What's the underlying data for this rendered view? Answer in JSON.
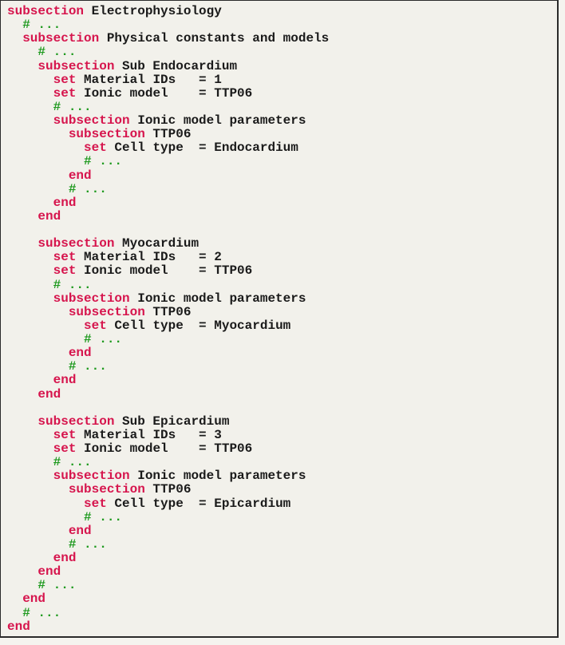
{
  "colors": {
    "keyword": "#d6154d",
    "comment": "#1f9a1f",
    "text": "#1a1a1a",
    "background": "#f2f1eb"
  },
  "lines": [
    {
      "indent": 0,
      "kw": "subsection",
      "text": " Electrophysiology"
    },
    {
      "indent": 1,
      "comment": "# ..."
    },
    {
      "indent": 1,
      "kw": "subsection",
      "text": " Physical constants and models"
    },
    {
      "indent": 2,
      "comment": "# ..."
    },
    {
      "indent": 2,
      "kw": "subsection",
      "text": " Sub Endocardium"
    },
    {
      "indent": 3,
      "kw": "set",
      "text": " Material IDs   = 1"
    },
    {
      "indent": 3,
      "kw": "set",
      "text": " Ionic model    = TTP06"
    },
    {
      "indent": 3,
      "comment": "# ..."
    },
    {
      "indent": 3,
      "kw": "subsection",
      "text": " Ionic model parameters"
    },
    {
      "indent": 4,
      "kw": "subsection",
      "text": " TTP06"
    },
    {
      "indent": 5,
      "kw": "set",
      "text": " Cell type  = Endocardium"
    },
    {
      "indent": 5,
      "comment": "# ..."
    },
    {
      "indent": 4,
      "kw": "end"
    },
    {
      "indent": 4,
      "comment": "# ..."
    },
    {
      "indent": 3,
      "kw": "end"
    },
    {
      "indent": 2,
      "kw": "end"
    },
    {
      "indent": 0
    },
    {
      "indent": 2,
      "kw": "subsection",
      "text": " Myocardium"
    },
    {
      "indent": 3,
      "kw": "set",
      "text": " Material IDs   = 2"
    },
    {
      "indent": 3,
      "kw": "set",
      "text": " Ionic model    = TTP06"
    },
    {
      "indent": 3,
      "comment": "# ..."
    },
    {
      "indent": 3,
      "kw": "subsection",
      "text": " Ionic model parameters"
    },
    {
      "indent": 4,
      "kw": "subsection",
      "text": " TTP06"
    },
    {
      "indent": 5,
      "kw": "set",
      "text": " Cell type  = Myocardium"
    },
    {
      "indent": 5,
      "comment": "# ..."
    },
    {
      "indent": 4,
      "kw": "end"
    },
    {
      "indent": 4,
      "comment": "# ..."
    },
    {
      "indent": 3,
      "kw": "end"
    },
    {
      "indent": 2,
      "kw": "end"
    },
    {
      "indent": 0
    },
    {
      "indent": 2,
      "kw": "subsection",
      "text": " Sub Epicardium"
    },
    {
      "indent": 3,
      "kw": "set",
      "text": " Material IDs   = 3"
    },
    {
      "indent": 3,
      "kw": "set",
      "text": " Ionic model    = TTP06"
    },
    {
      "indent": 3,
      "comment": "# ..."
    },
    {
      "indent": 3,
      "kw": "subsection",
      "text": " Ionic model parameters"
    },
    {
      "indent": 4,
      "kw": "subsection",
      "text": " TTP06"
    },
    {
      "indent": 5,
      "kw": "set",
      "text": " Cell type  = Epicardium"
    },
    {
      "indent": 5,
      "comment": "# ..."
    },
    {
      "indent": 4,
      "kw": "end"
    },
    {
      "indent": 4,
      "comment": "# ..."
    },
    {
      "indent": 3,
      "kw": "end"
    },
    {
      "indent": 2,
      "kw": "end"
    },
    {
      "indent": 2,
      "comment": "# ..."
    },
    {
      "indent": 1,
      "kw": "end"
    },
    {
      "indent": 1,
      "comment": "# ..."
    },
    {
      "indent": 0,
      "kw": "end"
    }
  ]
}
